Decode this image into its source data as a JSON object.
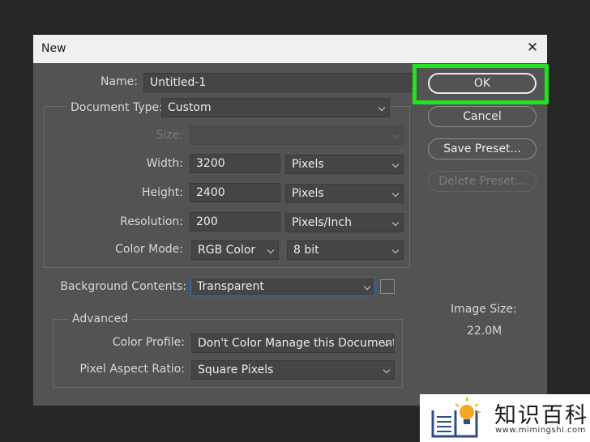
{
  "dialog": {
    "title": "New"
  },
  "form": {
    "name_label": "Name:",
    "name_value": "Untitled-1",
    "doc_type_label": "Document Type:",
    "doc_type_value": "Custom",
    "size_label": "Size:",
    "width_label": "Width:",
    "width_value": "3200",
    "width_unit": "Pixels",
    "height_label": "Height:",
    "height_value": "2400",
    "height_unit": "Pixels",
    "resolution_label": "Resolution:",
    "resolution_value": "200",
    "resolution_unit": "Pixels/Inch",
    "color_mode_label": "Color Mode:",
    "color_mode_value": "RGB Color",
    "bit_depth_value": "8 bit",
    "background_label": "Background Contents:",
    "background_value": "Transparent"
  },
  "advanced": {
    "title": "Advanced",
    "color_profile_label": "Color Profile:",
    "color_profile_value": "Don't Color Manage this Document",
    "pixel_aspect_label": "Pixel Aspect Ratio:",
    "pixel_aspect_value": "Square Pixels"
  },
  "buttons": {
    "ok": "OK",
    "cancel": "Cancel",
    "save_preset": "Save Preset...",
    "delete_preset": "Delete Preset..."
  },
  "image_size": {
    "label": "Image Size:",
    "value": "22.0M"
  },
  "watermark": {
    "name": "知识百科",
    "url": "www.mimingshi.com"
  },
  "colors": {
    "highlight": "#1fe41f",
    "dialog_bg": "#535353",
    "focus_border": "#2e6fd1"
  }
}
